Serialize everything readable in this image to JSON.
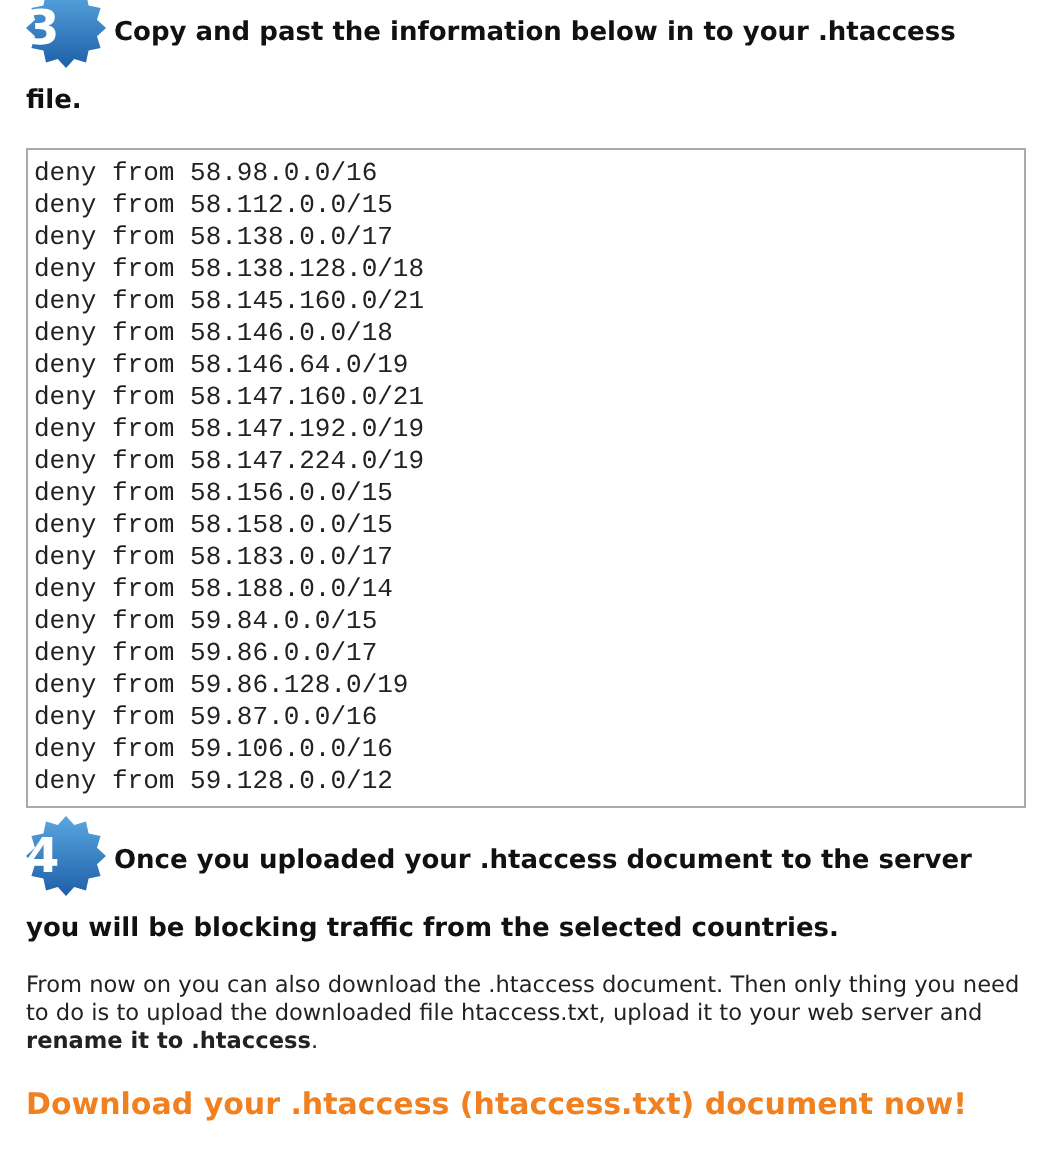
{
  "step_3": {
    "number": "3",
    "heading_lines": [
      "Copy and past the information below in to your .htaccess",
      "file."
    ]
  },
  "htaccess_box": {
    "lines": [
      "deny from 58.98.0.0/16",
      "deny from 58.112.0.0/15",
      "deny from 58.138.0.0/17",
      "deny from 58.138.128.0/18",
      "deny from 58.145.160.0/21",
      "deny from 58.146.0.0/18",
      "deny from 58.146.64.0/19",
      "deny from 58.147.160.0/21",
      "deny from 58.147.192.0/19",
      "deny from 58.147.224.0/19",
      "deny from 58.156.0.0/15",
      "deny from 58.158.0.0/15",
      "deny from 58.183.0.0/17",
      "deny from 58.188.0.0/14",
      "deny from 59.84.0.0/15",
      "deny from 59.86.0.0/17",
      "deny from 59.86.128.0/19",
      "deny from 59.87.0.0/16",
      "deny from 59.106.0.0/16",
      "deny from 59.128.0.0/12"
    ]
  },
  "step_4": {
    "number": "4",
    "heading_lines": [
      "Once you uploaded your .htaccess document to the server",
      "you will be blocking traffic from the selected countries."
    ]
  },
  "note": "From now on you can also download the .htaccess document. Then only thing you need to do is to upload the downloaded file htaccess.txt, upload it to your web server and **rename it to .htaccess**.",
  "download_link": "Download your .htaccess (htaccess.txt) document now!"
}
